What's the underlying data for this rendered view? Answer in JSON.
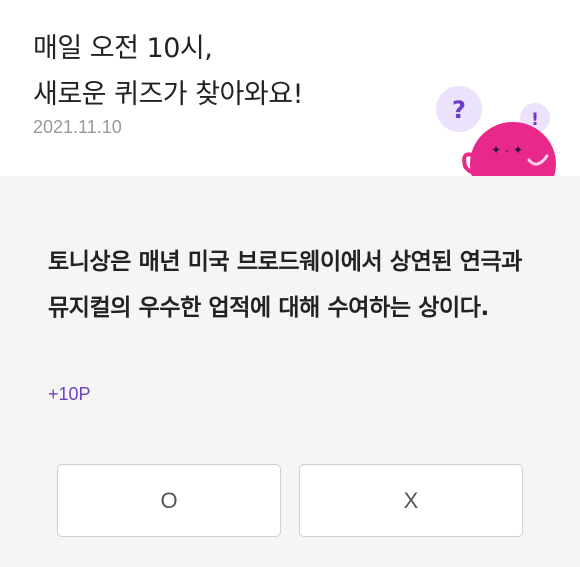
{
  "header": {
    "title_line1": "매일 오전 10시,",
    "title_line2": "새로운 퀴즈가 찾아와요!",
    "date": "2021.11.10",
    "mascot_icon": "pink-character-question-icon",
    "colors": {
      "mascot_pink": "#e8288a",
      "bubble_bg": "#ece2fb",
      "bubble_mark": "#6a3cc7"
    }
  },
  "quiz": {
    "question": "토니상은 매년 미국 브로드웨이에서 상연된 연극과 뮤지컬의 우수한 업적에 대해 수여하는 상이다.",
    "points": "+10P",
    "answers": {
      "o_label": "O",
      "x_label": "X"
    },
    "colors": {
      "points": "#6f42c1",
      "background": "#f5f5f5"
    }
  }
}
